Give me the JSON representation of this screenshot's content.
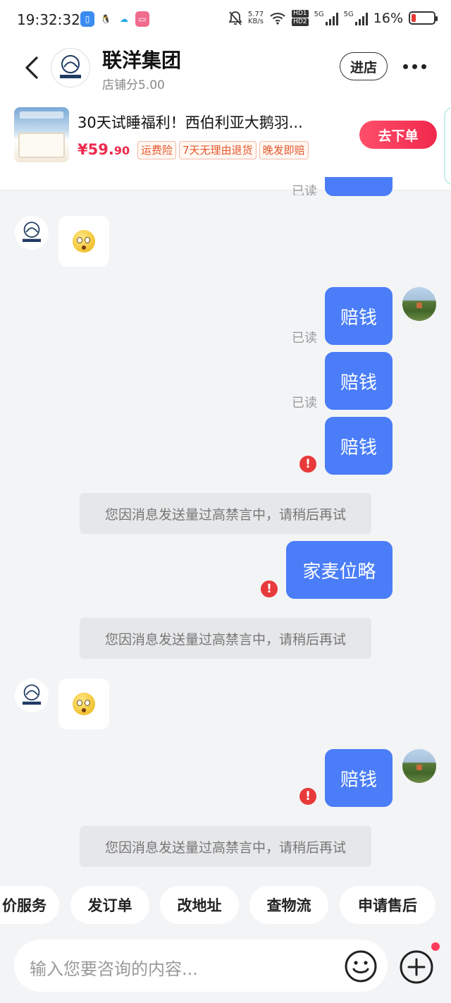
{
  "status_bar": {
    "time": "19:32:32",
    "net_speed": "5.77",
    "net_unit": "KB/s",
    "hd1": "HD1",
    "hd2": "HD2",
    "sig1": "5G",
    "sig2": "5G",
    "battery": "16%",
    "icons": [
      "app-icon-blue",
      "qq-icon",
      "chat-app-icon",
      "app-icon-pink",
      "mute-bell-icon",
      "wifi-icon",
      "signal-icon",
      "battery-icon"
    ]
  },
  "header": {
    "shop_name": "联洋集团",
    "shop_score": "店铺分5.00",
    "enter_label": "进店"
  },
  "product": {
    "title": "30天试睡福利！西伯利亚大鹅羽...",
    "price_main": "¥59.",
    "price_dec": "90",
    "tags": [
      "运费险",
      "7天无理由退货",
      "晚发即赔"
    ],
    "order_label": "去下单"
  },
  "chat": {
    "read_top": "已读",
    "read_label": "已读",
    "messages": [
      {
        "text": "赔钱"
      },
      {
        "text": "赔钱"
      },
      {
        "text": "赔钱"
      },
      {
        "text": "家麦位略"
      },
      {
        "text": "赔钱"
      }
    ],
    "error_mark": "!",
    "system_notice": "您因消息发送量过高禁言中，请稍后再试"
  },
  "quick_actions": [
    "价服务",
    "发订单",
    "改地址",
    "查物流",
    "申请售后"
  ],
  "input": {
    "placeholder": "输入您要咨询的内容..."
  },
  "colors": {
    "accent_blue": "#4a7df7",
    "brand_red": "#f1284d",
    "error_red": "#e83a3a"
  }
}
